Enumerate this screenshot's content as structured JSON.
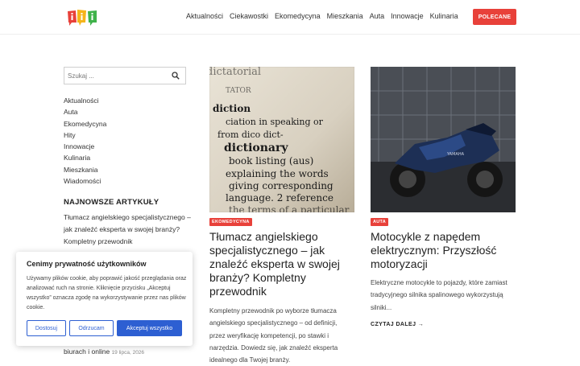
{
  "header": {
    "nav": [
      "Aktualności",
      "Ciekawostki",
      "Ekomedycyna",
      "Mieszkania",
      "Auta",
      "Innowacje",
      "Kulinaria"
    ],
    "cta": "POLECANE"
  },
  "sidebar": {
    "search_placeholder": "Szukaj ...",
    "categories": [
      "Aktualności",
      "Auta",
      "Ekomedycyna",
      "Hity",
      "Innowacje",
      "Kulinaria",
      "Mieszkania",
      "Wiadomości"
    ],
    "newest_title": "NAJNOWSZE ARTYKUŁY",
    "newest": [
      {
        "title": "Tłumacz angielskiego specjalistycznego – jak znaleźć eksperta w swojej branży? Kompletny przewodnik"
      },
      {
        "title_tail": "biurach i online",
        "date": "19 lipca, 2026"
      }
    ]
  },
  "cookie": {
    "title": "Cenimy prywatność użytkowników",
    "text": "Używamy plików cookie, aby poprawić jakość przeglądania oraz analizować ruch na stronie. Kliknięcie przycisku „Akceptuj wszystko” oznacza zgodę na wykorzystywanie przez nas plików cookie.",
    "buttons": [
      "Dostosuj",
      "Odrzucam",
      "Akceptuj wszystko"
    ]
  },
  "posts": [
    {
      "category": "EKOMEDYCYNA",
      "title": "Tłumacz angielskiego specjalistycznego – jak znaleźć eksperta w swojej branży? Kompletny przewodnik",
      "excerpt": "Kompletny przewodnik po wyborze tłumacza angielskiego specjalistycznego – od definicji, przez weryfikację kompetencji, po stawki i narzędzia. Dowiedz się, jak znaleźć eksperta idealnego dla Twojej branży.",
      "image_words": [
        "dictatorial",
        "TATOR",
        "diction",
        "ciation in speaking or",
        "from dico dict-",
        "dictionary",
        "book listing (aus)",
        "explaining the words",
        "giving corresponding",
        "language. 2 reference",
        "the terms of a particular"
      ]
    },
    {
      "category": "AUTA",
      "title": "Motocykle z napędem elektrycznym: Przyszłość motoryzacji",
      "excerpt": "Elektryczne motocykle to pojazdy, które zamiast tradycyjnego silnika spalinowego wykorzystują silniki...",
      "read_more": "CZYTAJ DALEJ",
      "image_text": "YAMAHA"
    }
  ],
  "colors": {
    "accent": "#e8413a",
    "cookie_blue": "#2d5fd2"
  }
}
